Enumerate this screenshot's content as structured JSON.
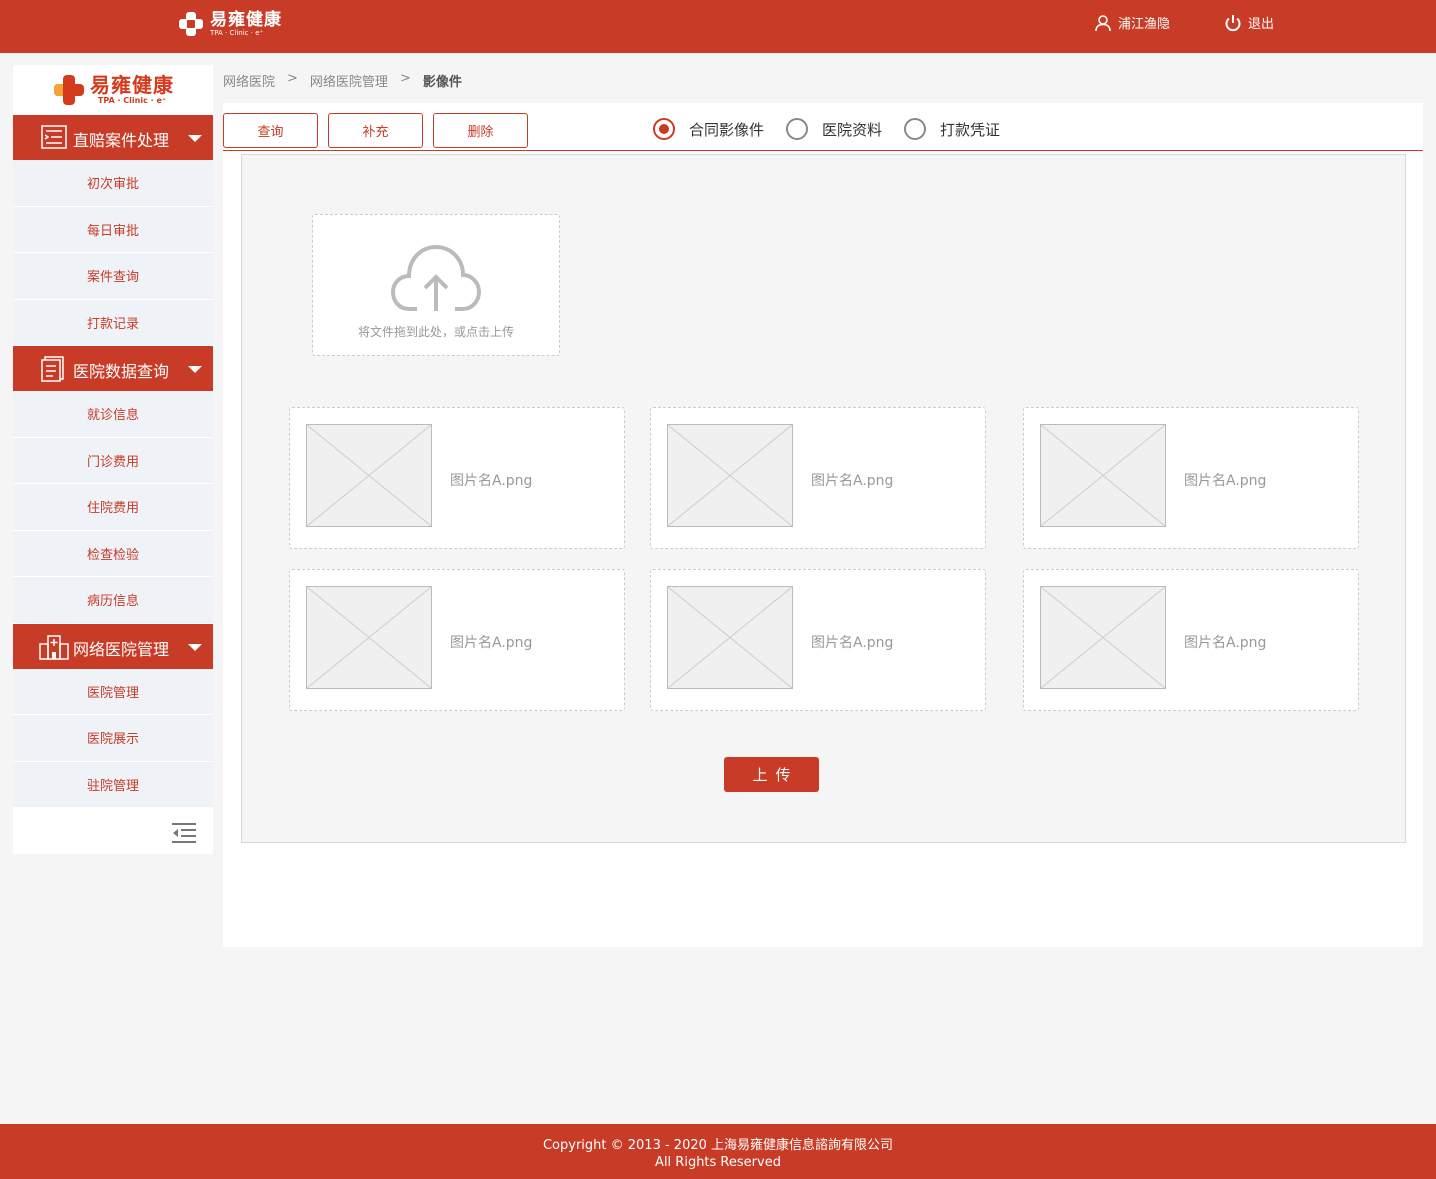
{
  "header": {
    "logo_text": "易雍健康",
    "logo_sub": "TPA · Clinic · e⁺",
    "user_name": "浦江渔隐",
    "logout_label": "退出"
  },
  "sidebar": {
    "logo_text": "易雍健康",
    "logo_sub": "TPA · Clinic · e⁺",
    "groups": [
      {
        "title": "直赔案件处理",
        "icon": "claims-icon",
        "items": [
          "初次审批",
          "每日审批",
          "案件查询",
          "打款记录"
        ]
      },
      {
        "title": "医院数据查询",
        "icon": "document-icon",
        "items": [
          "就诊信息",
          "门诊费用",
          "住院费用",
          "检查检验",
          "病历信息"
        ]
      },
      {
        "title": "网络医院管理",
        "icon": "hospital-icon",
        "items": [
          "医院管理",
          "医院展示",
          "驻院管理"
        ]
      }
    ],
    "collapse_icon": "menu-collapse-icon"
  },
  "breadcrumb": [
    "网络医院",
    ">",
    "网络医院管理",
    ">",
    "影像件"
  ],
  "toolbar": {
    "query_label": "查询",
    "supplement_label": "补充",
    "delete_label": "删除",
    "radios": [
      {
        "label": "合同影像件",
        "checked": true
      },
      {
        "label": "医院资料",
        "checked": false
      },
      {
        "label": "打款凭证",
        "checked": false
      }
    ]
  },
  "upload": {
    "hint": "将文件拖到此处，或点击上传",
    "button_label": "上传"
  },
  "files": [
    "图片名A.png",
    "图片名A.png",
    "图片名A.png",
    "图片名A.png",
    "图片名A.png",
    "图片名A.png"
  ],
  "footer": {
    "line1": "Copyright © 2013 - 2020 上海易雍健康信息諮詢有限公司",
    "line2": "All Rights Reserved"
  },
  "colors": {
    "brand": "#c83b26",
    "sidebar_item_bg": "#eff3f8"
  }
}
